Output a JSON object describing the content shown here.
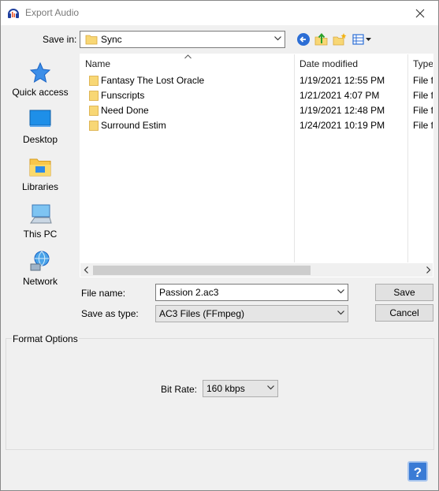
{
  "window": {
    "title": "Export Audio"
  },
  "save_in": {
    "label": "Save in:",
    "value": "Sync"
  },
  "toolbar": {
    "icons": [
      "back-icon",
      "up-folder-icon",
      "new-folder-icon",
      "view-menu-icon"
    ]
  },
  "places": [
    {
      "name": "quick-access",
      "label": "Quick access",
      "icon": "star-icon"
    },
    {
      "name": "desktop",
      "label": "Desktop",
      "icon": "desktop-icon"
    },
    {
      "name": "libraries",
      "label": "Libraries",
      "icon": "libraries-icon"
    },
    {
      "name": "this-pc",
      "label": "This PC",
      "icon": "computer-icon"
    },
    {
      "name": "network",
      "label": "Network",
      "icon": "network-icon"
    }
  ],
  "file_list": {
    "columns": [
      "Name",
      "Date modified",
      "Type"
    ],
    "rows": [
      {
        "name": "Fantasy The Lost Oracle",
        "date": "1/19/2021 12:55 PM",
        "type": "File fo"
      },
      {
        "name": "Funscripts",
        "date": "1/21/2021 4:07 PM",
        "type": "File fo"
      },
      {
        "name": "Need Done",
        "date": "1/19/2021 12:48 PM",
        "type": "File fo"
      },
      {
        "name": "Surround Estim",
        "date": "1/24/2021 10:19 PM",
        "type": "File fo"
      }
    ]
  },
  "file_name": {
    "label": "File name:",
    "value": "Passion 2.ac3"
  },
  "save_as_type": {
    "label": "Save as type:",
    "value": "AC3 Files (FFmpeg)"
  },
  "buttons": {
    "save": "Save",
    "cancel": "Cancel",
    "help": "?"
  },
  "format_options": {
    "title": "Format Options",
    "bit_rate_label": "Bit Rate:",
    "bit_rate_value": "160 kbps"
  },
  "colors": {
    "accent": "#3a7bd5",
    "folder": "#f8d775"
  }
}
